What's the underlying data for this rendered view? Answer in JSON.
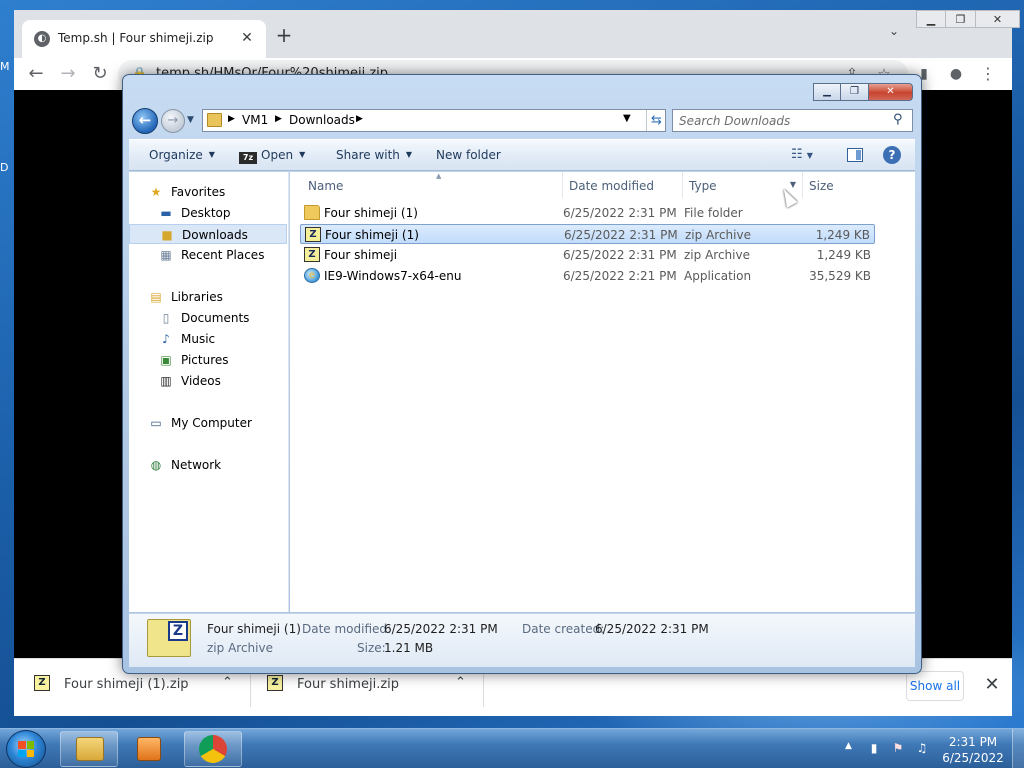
{
  "desktop": {
    "edge_letters": [
      "M",
      "D"
    ]
  },
  "browser": {
    "tab_title": "Temp.sh | Four shimeji.zip",
    "url": "temp.sh/HMsOr/Four%20shimeji.zip",
    "downloads": [
      {
        "name": "Four shimeji (1).zip"
      },
      {
        "name": "Four shimeji.zip"
      }
    ],
    "show_all_label": "Show all"
  },
  "explorer": {
    "breadcrumbs": [
      "VM1",
      "Downloads"
    ],
    "search_placeholder": "Search Downloads",
    "toolbar": {
      "organize": "Organize",
      "open": "Open",
      "share_with": "Share with",
      "new_folder": "New folder"
    },
    "nav": {
      "favorites": "Favorites",
      "desktop": "Desktop",
      "downloads": "Downloads",
      "recent_places": "Recent Places",
      "libraries": "Libraries",
      "documents": "Documents",
      "music": "Music",
      "pictures": "Pictures",
      "videos": "Videos",
      "my_computer": "My Computer",
      "network": "Network"
    },
    "columns": {
      "name": "Name",
      "date_modified": "Date modified",
      "type": "Type",
      "size": "Size"
    },
    "files": [
      {
        "name": "Four shimeji (1)",
        "date": "6/25/2022 2:31 PM",
        "type": "File folder",
        "size": "",
        "icon": "folder-icon"
      },
      {
        "name": "Four shimeji (1)",
        "date": "6/25/2022 2:31 PM",
        "type": "zip Archive",
        "size": "1,249 KB",
        "icon": "zip-icon"
      },
      {
        "name": "Four shimeji",
        "date": "6/25/2022 2:31 PM",
        "type": "zip Archive",
        "size": "1,249 KB",
        "icon": "zip-icon"
      },
      {
        "name": "IE9-Windows7-x64-enu",
        "date": "6/25/2022 2:21 PM",
        "type": "Application",
        "size": "35,529 KB",
        "icon": "ie-installer-icon"
      }
    ],
    "details": {
      "name": "Four shimeji (1)",
      "type": "zip Archive",
      "date_modified_label": "Date modified:",
      "date_modified": "6/25/2022 2:31 PM",
      "date_created_label": "Date created:",
      "date_created": "6/25/2022 2:31 PM",
      "size_label": "Size:",
      "size": "1.21 MB"
    }
  },
  "taskbar": {
    "time": "2:31 PM",
    "date": "6/25/2022"
  },
  "colors": {
    "desktop_blue": "#1b5ea8",
    "selection": "#c1dcfb",
    "link_blue": "#1a73e8"
  }
}
